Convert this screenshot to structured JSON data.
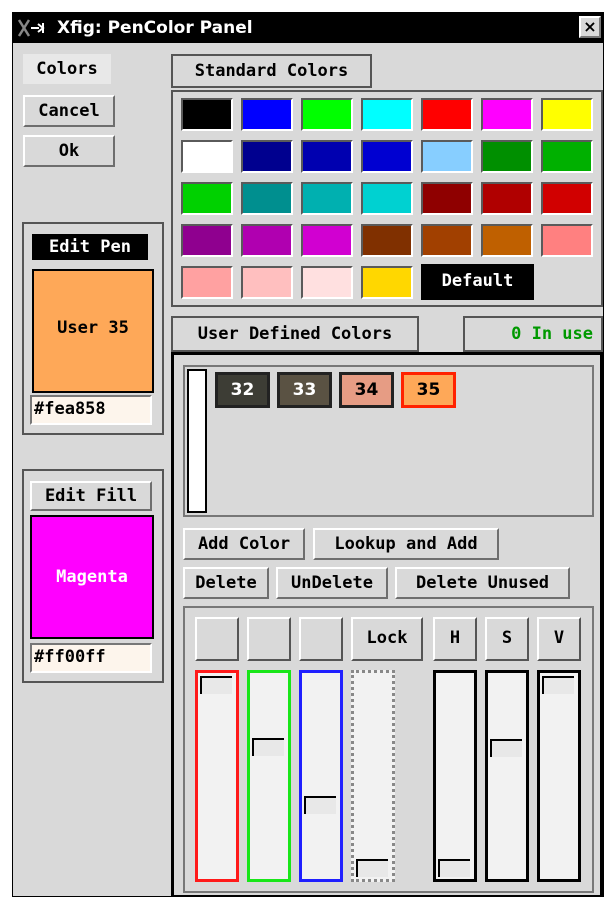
{
  "window": {
    "title": "Xfig: PenColor  Panel",
    "close_glyph": "×"
  },
  "left": {
    "colors_label": "Colors",
    "cancel_label": "Cancel",
    "ok_label": "Ok",
    "edit_pen": {
      "label": "Edit Pen",
      "color_name": "User 35",
      "hex": "#fea858",
      "color": "#fea858"
    },
    "edit_fill": {
      "label": "Edit Fill",
      "color_name": "Magenta",
      "hex": "#ff00ff",
      "color": "#ff00ff"
    }
  },
  "standard_colors": {
    "label": "Standard Colors",
    "swatches": [
      "#000000",
      "#0000ff",
      "#00ff00",
      "#00ffff",
      "#ff0000",
      "#ff00ff",
      "#ffff00",
      "#ffffff",
      "#00008f",
      "#0000b0",
      "#0000d1",
      "#87ceff",
      "#008f00",
      "#00b000",
      "#00d100",
      "#008f8f",
      "#00b0b0",
      "#00d1d1",
      "#8f0000",
      "#b00000",
      "#d10000",
      "#8f008f",
      "#b000b0",
      "#d100d1",
      "#803000",
      "#a14000",
      "#bf6000",
      "#ff8080",
      "#ffa1a1",
      "#ffbfbf",
      "#ffe0e0",
      "#ffd700"
    ],
    "default_label": "Default"
  },
  "user_defined": {
    "label": "User Defined Colors",
    "in_use": "0 In use",
    "swatches": [
      {
        "num": "32",
        "color": "#3d3d35",
        "text_color": "#ffffff"
      },
      {
        "num": "33",
        "color": "#5a5243",
        "text_color": "#ffffff"
      },
      {
        "num": "34",
        "color": "#e69c84",
        "text_color": "#000000"
      },
      {
        "num": "35",
        "color": "#fea858",
        "text_color": "#000000"
      }
    ],
    "add_color": "Add Color",
    "lookup_add": "Lookup and Add",
    "delete": "Delete",
    "undelete": "UnDelete",
    "delete_unused": "Delete Unused"
  },
  "mixer": {
    "lock_label": "Lock",
    "h_label": "H",
    "s_label": "S",
    "v_label": "V",
    "red_level": 0.996,
    "green_level": 0.659,
    "blue_level": 0.345,
    "lock_level": 0.0,
    "h_level": 0.0,
    "s_level": 0.652,
    "v_level": 0.996,
    "slider_colors": {
      "red": "#ff1a1a",
      "green": "#19e619",
      "blue": "#1f1fff"
    }
  }
}
